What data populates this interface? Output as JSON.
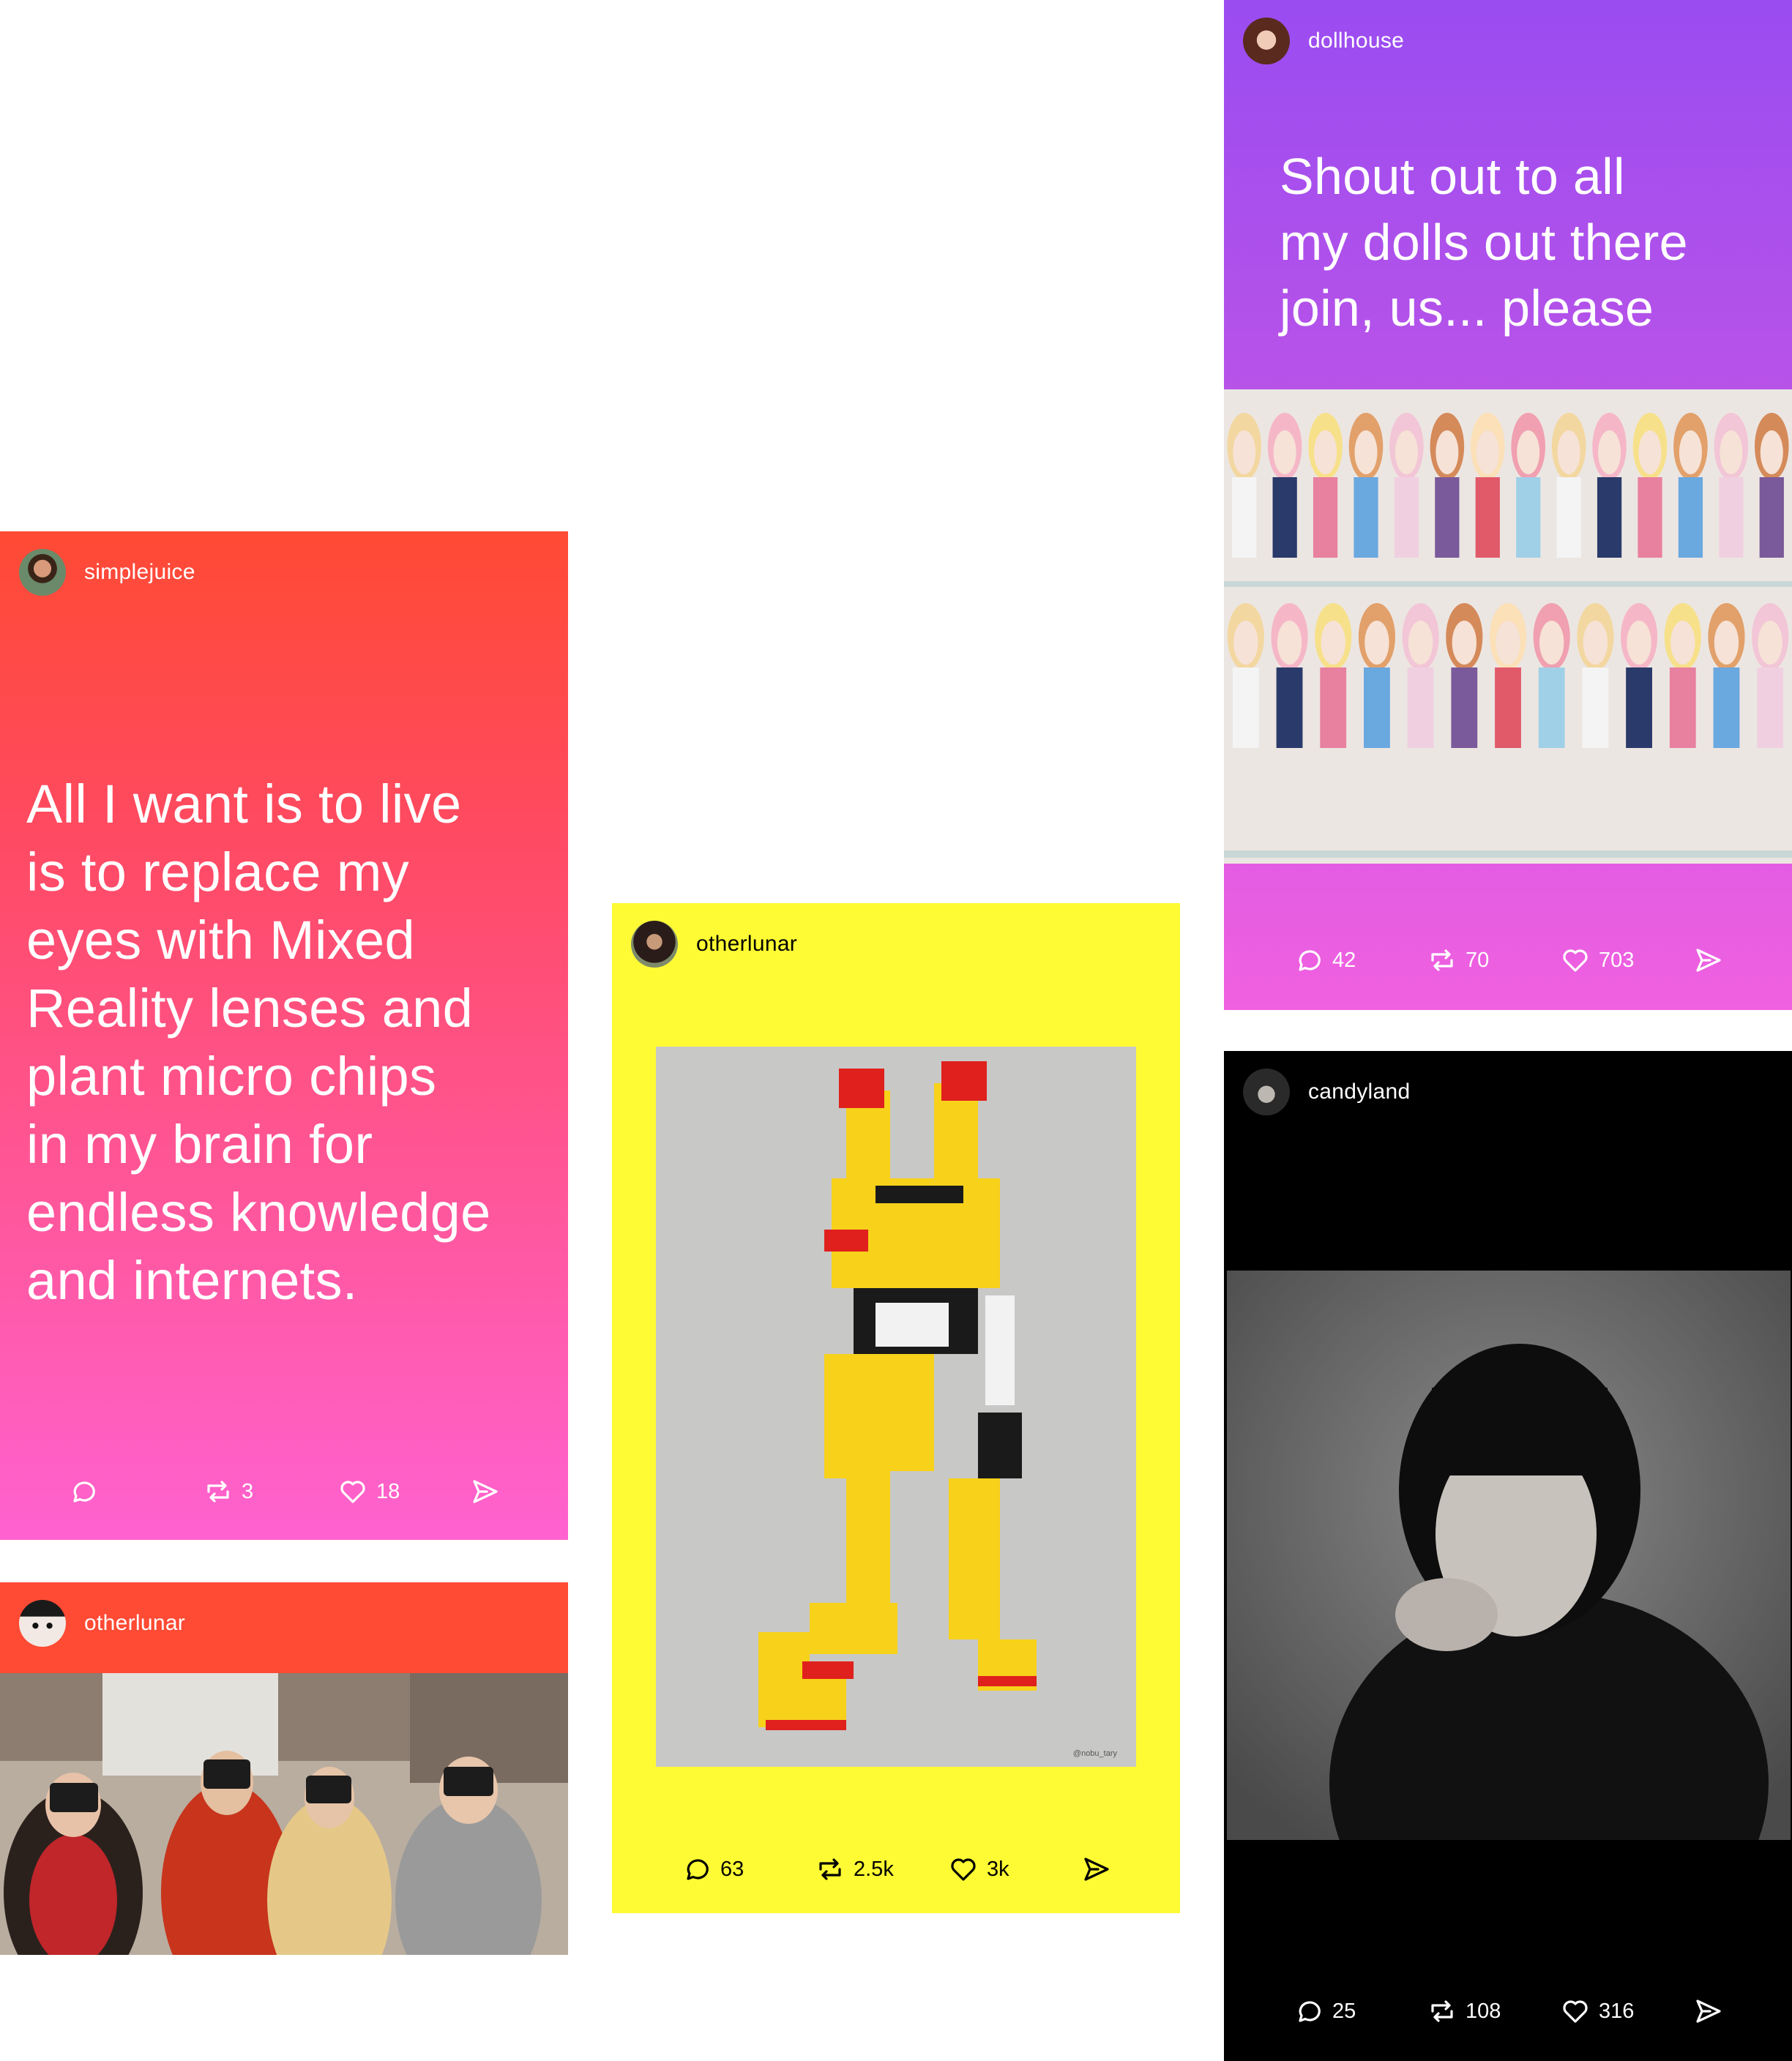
{
  "posts": {
    "simplejuice": {
      "username": "simplejuice",
      "text_lines": [
        "All I want is to live",
        "is to replace my",
        "eyes with Mixed",
        "Reality lenses and",
        "plant micro chips",
        "in my brain for",
        "endless knowledge",
        "and internets."
      ],
      "reblogs": "3",
      "likes": "18"
    },
    "otherlunar_vr": {
      "username": "otherlunar"
    },
    "otherlunar_lego": {
      "username": "otherlunar",
      "photo_credit": "@nobu_tary",
      "comments": "63",
      "reblogs": "2.5k",
      "likes": "3k"
    },
    "dollhouse": {
      "username": "dollhouse",
      "text_lines": [
        "Shout out to all",
        "my dolls out there",
        "join, us... please"
      ],
      "comments": "42",
      "reblogs": "70",
      "likes": "703"
    },
    "candyland": {
      "username": "candyland",
      "comments": "25",
      "reblogs": "108",
      "likes": "316"
    }
  },
  "colors": {
    "red": "#ff4a34",
    "pink": "#ff62d0",
    "yellow": "#fefb34",
    "purple": "#9a4cf1",
    "magenta": "#f060e0",
    "black": "#000000",
    "white": "#ffffff"
  },
  "icons": [
    "comment-icon",
    "reblog-icon",
    "heart-icon",
    "share-icon"
  ]
}
